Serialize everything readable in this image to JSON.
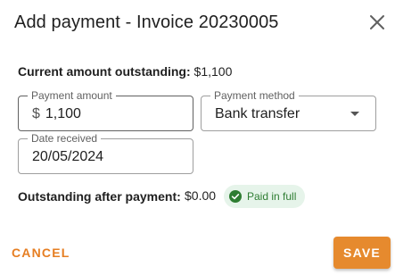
{
  "dialog": {
    "title": "Add payment - Invoice 20230005",
    "close_icon": "close-icon"
  },
  "summary": {
    "current_label": "Current amount outstanding:",
    "current_value": "$1,100"
  },
  "fields": {
    "amount": {
      "label": "Payment amount",
      "prefix": "$",
      "value": "1,100"
    },
    "method": {
      "label": "Payment method",
      "value": "Bank transfer",
      "icon": "dropdown-arrow-icon"
    },
    "date": {
      "label": "Date received",
      "value": "20/05/2024"
    }
  },
  "after": {
    "label": "Outstanding after payment:",
    "value": "$0.00",
    "status_text": "Paid in full",
    "status_icon": "check-circle-icon",
    "status_color": "#2e7d32",
    "status_bg": "#e6f4ea"
  },
  "actions": {
    "cancel_label": "CANCEL",
    "save_label": "SAVE",
    "accent_color": "#e68a2e"
  }
}
